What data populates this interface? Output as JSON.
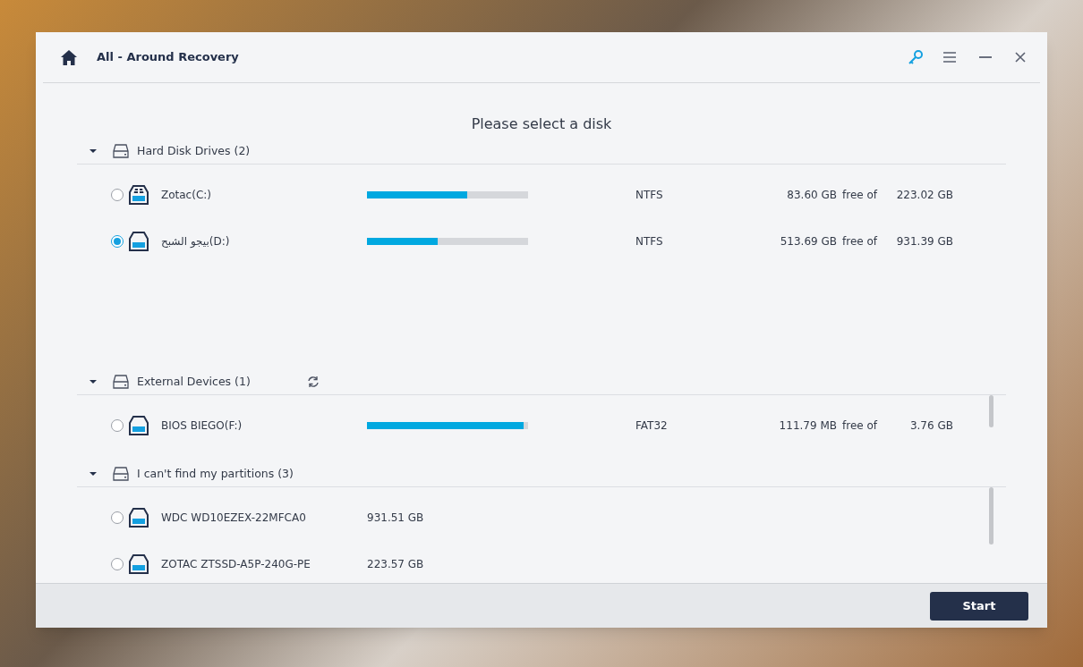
{
  "window": {
    "title": "All - Around Recovery"
  },
  "heading": "Please select a disk",
  "sections": [
    {
      "title": "Hard Disk Drives (2)",
      "expanded": true,
      "items": [
        {
          "kind": "system_volume",
          "name": "Zotac(C:)",
          "selected": false,
          "level": 0.62,
          "filesystem": "NTFS",
          "free": "83.60 GB",
          "free_of": "free of",
          "total": "223.02 GB"
        },
        {
          "kind": "volume",
          "name": "بيجو الشبح(D:)",
          "selected": true,
          "level": 0.44,
          "filesystem": "NTFS",
          "free": "513.69 GB",
          "free_of": "free of",
          "total": "931.39 GB"
        }
      ]
    },
    {
      "title": "External Devices (1)",
      "expanded": true,
      "refresh_button": true,
      "items": [
        {
          "kind": "volume",
          "name": "BIOS BIEGO(F:)",
          "selected": false,
          "level": 0.97,
          "filesystem": "FAT32",
          "free": "111.79 MB",
          "free_of": "free of",
          "total": "3.76 GB"
        }
      ]
    },
    {
      "title": "I can't find my partitions (3)",
      "expanded": true,
      "items": [
        {
          "kind": "disk",
          "name": "WDC WD10EZEX-22MFCA0",
          "selected": false,
          "size": "931.51 GB"
        },
        {
          "kind": "disk",
          "name": "ZOTAC ZTSSD-A5P-240G-PE",
          "selected": false,
          "size": "223.57 GB"
        }
      ]
    }
  ],
  "footer": {
    "button": "Start"
  }
}
